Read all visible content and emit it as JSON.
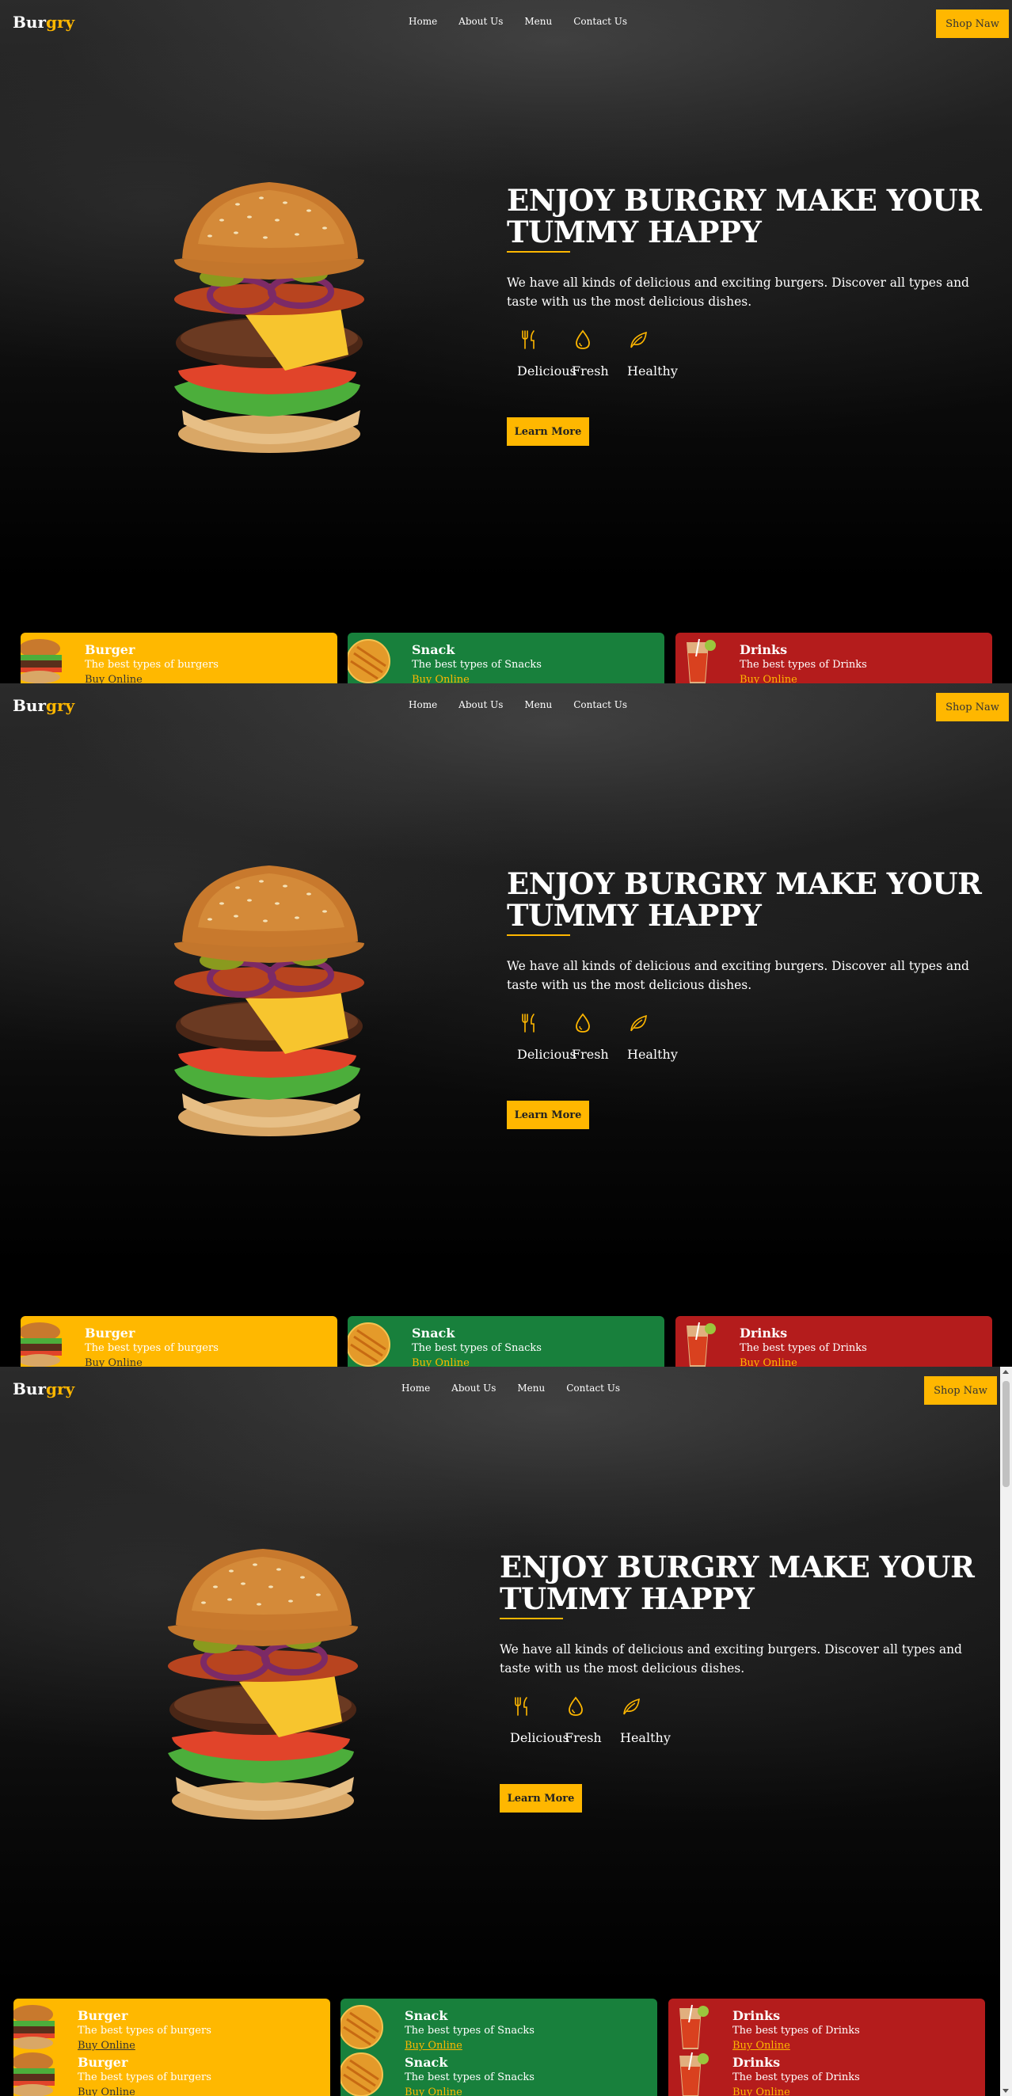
{
  "brand": {
    "logo_part1": "Bur",
    "logo_part2": "gry",
    "accent": "#ffb700"
  },
  "nav": {
    "items": [
      "Home",
      "About Us",
      "Menu",
      "Contact Us"
    ],
    "shop_label": "Shop Naw"
  },
  "hero": {
    "title": "ENJOY BURGRY MAKE YOUR TUMMY HAPPY",
    "description": "We have all kinds of delicious and exciting burgers. Discover all types and taste with us the most delicious dishes.",
    "features": [
      {
        "icon": "fork-knife-icon",
        "label": "Delicious"
      },
      {
        "icon": "drop-icon",
        "label": "Fresh"
      },
      {
        "icon": "leaf-icon",
        "label": "Healthy"
      }
    ],
    "learn_label": "Learn More"
  },
  "cards": [
    {
      "title": "Burger",
      "subtitle": "The best types of burgers",
      "link": "Buy Online",
      "color": "#ffb800"
    },
    {
      "title": "Snack",
      "subtitle": "The best types of Snacks",
      "link": "Buy Online",
      "color": "#18803c"
    },
    {
      "title": "Drinks",
      "subtitle": "The best types of Drinks",
      "link": "Buy Online",
      "color": "#b41c1c"
    }
  ]
}
